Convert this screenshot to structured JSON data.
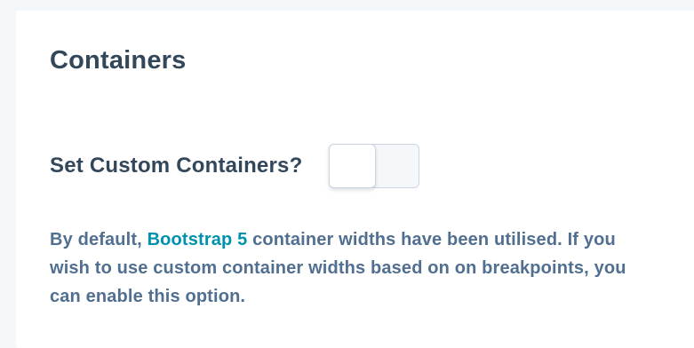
{
  "section": {
    "title": "Containers"
  },
  "field": {
    "label": "Set Custom Containers?",
    "toggle_on": false
  },
  "help": {
    "before_link": "By default, ",
    "link_text": "Bootstrap 5",
    "after_link": " container widths have been utilised. If you wish to use custom container widths based on on breakpoints, you can enable this option."
  },
  "colors": {
    "heading": "#33475b",
    "body_text": "#516f90",
    "link": "#0091ae",
    "toggle_border": "#cbd6e2"
  }
}
